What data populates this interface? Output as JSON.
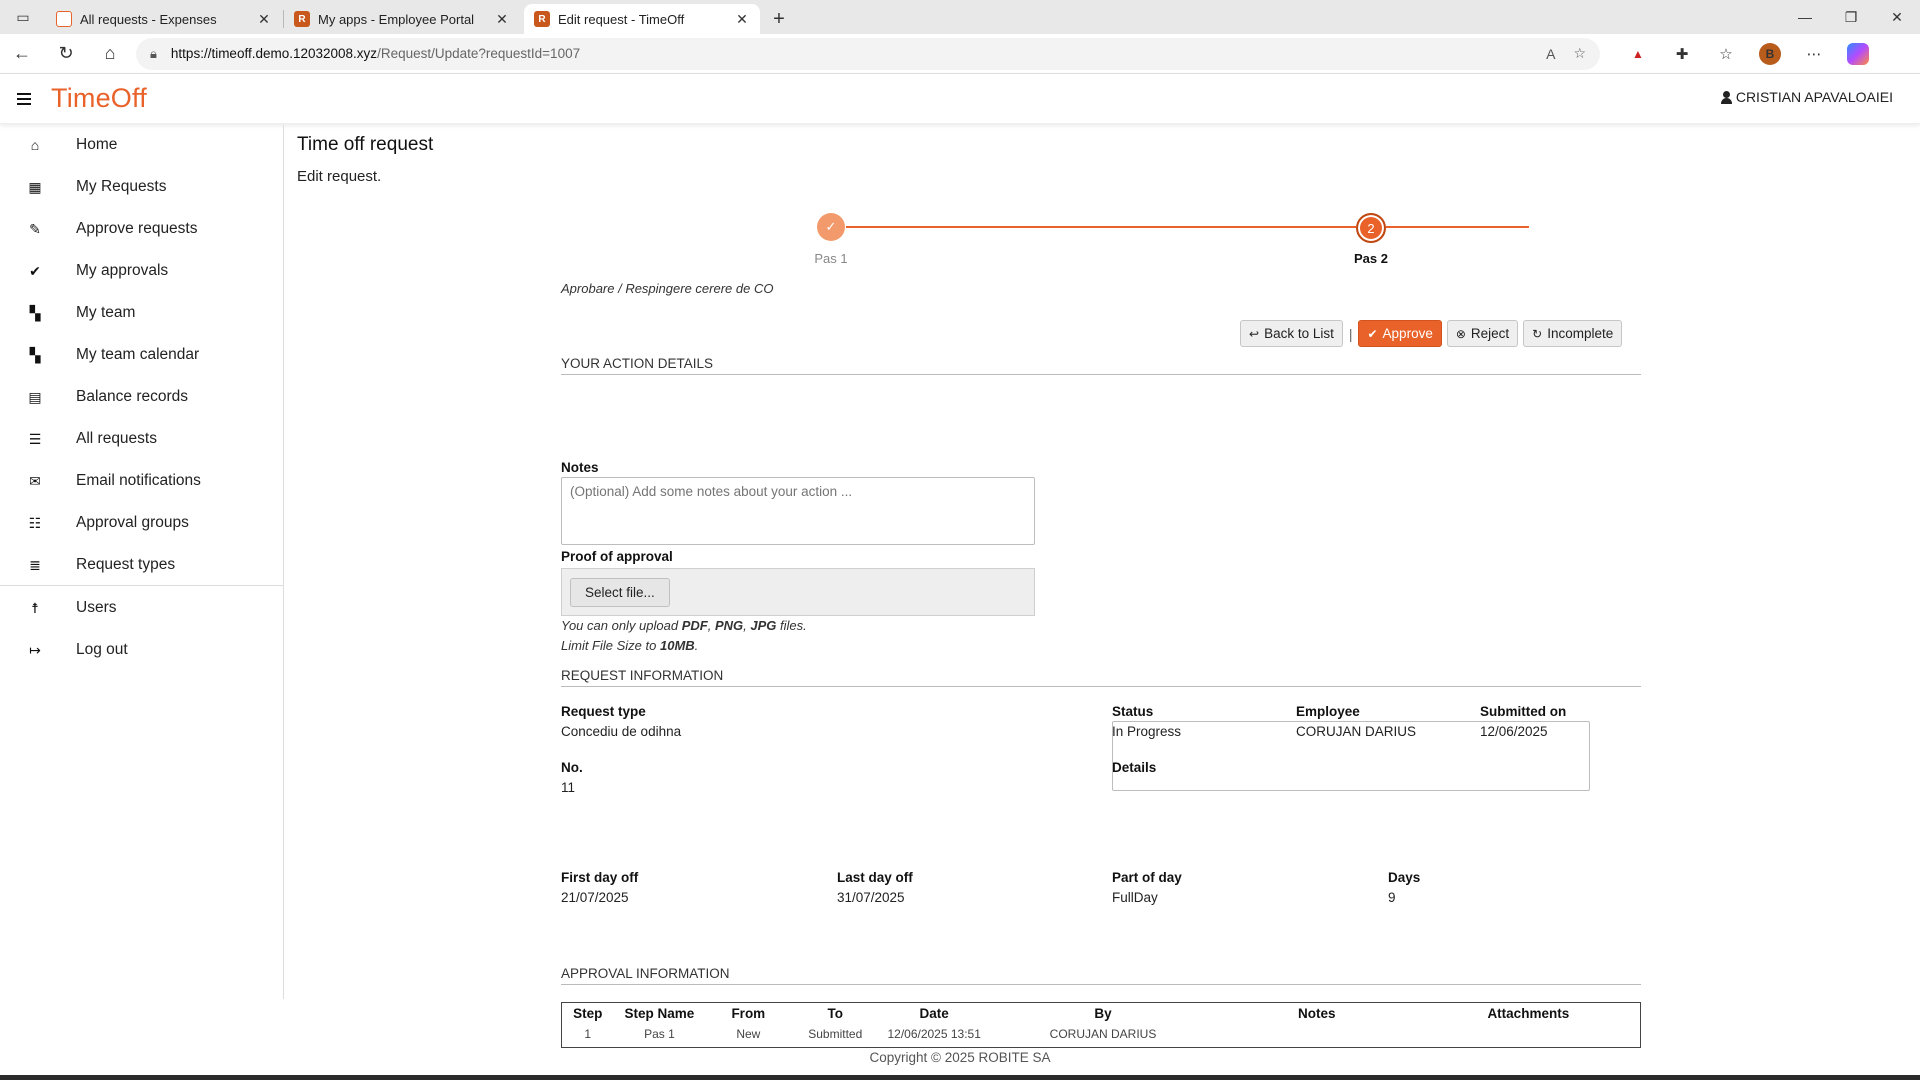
{
  "browser": {
    "tabs": [
      {
        "title": "All requests - Expenses",
        "active": false
      },
      {
        "title": "My apps - Employee Portal",
        "active": false
      },
      {
        "title": "Edit request - TimeOff",
        "active": true
      }
    ],
    "url_host": "https://timeoff.demo.12032008.xyz",
    "url_path": "/Request/Update?requestId=1007"
  },
  "app": {
    "brand": "TimeOff",
    "user": "CRISTIAN APAVALOAIEI",
    "accent": "#e8622a"
  },
  "sidebar": {
    "items": [
      {
        "label": "Home",
        "icon": "home-icon"
      },
      {
        "label": "My Requests",
        "icon": "calendar-icon"
      },
      {
        "label": "Approve requests",
        "icon": "pencil-icon"
      },
      {
        "label": "My approvals",
        "icon": "check-circle-icon"
      },
      {
        "label": "My team",
        "icon": "grid-icon"
      },
      {
        "label": "My team calendar",
        "icon": "grid-icon"
      },
      {
        "label": "Balance records",
        "icon": "calendar-balance-icon"
      },
      {
        "label": "All requests",
        "icon": "list-icon"
      },
      {
        "label": "Email notifications",
        "icon": "envelope-icon"
      },
      {
        "label": "Approval groups",
        "icon": "list-check-icon"
      },
      {
        "label": "Request types",
        "icon": "list-lines-icon"
      },
      {
        "label": "Users",
        "icon": "person-icon"
      },
      {
        "label": "Log out",
        "icon": "logout-icon"
      }
    ]
  },
  "page": {
    "title": "Time off request",
    "subtitle": "Edit request."
  },
  "stepper": {
    "steps": [
      {
        "label": "Pas 1",
        "status": "done",
        "marker": "✓"
      },
      {
        "label": "Pas 2",
        "status": "current",
        "marker": "2"
      }
    ],
    "caption": "Aprobare / Respingere cerere de CO"
  },
  "actions": {
    "back": "Back to List",
    "separator": "|",
    "approve": "Approve",
    "reject": "Reject",
    "incomplete": "Incomplete"
  },
  "action_details": {
    "section_title": "YOUR ACTION DETAILS",
    "notes_label": "Notes",
    "notes_placeholder": "(Optional) Add some notes about your action ...",
    "proof_label": "Proof of approval",
    "select_file": "Select file...",
    "hint_prefix": "You can only upload ",
    "hint_pdf": "PDF",
    "hint_comma1": ", ",
    "hint_png": "PNG",
    "hint_comma2": ", ",
    "hint_jpg": "JPG",
    "hint_suffix": " files.",
    "limit_prefix": "Limit File Size to ",
    "limit_value": "10MB",
    "limit_suffix": "."
  },
  "request_info": {
    "section_title": "REQUEST INFORMATION",
    "request_type_label": "Request type",
    "request_type": "Concediu de odihna",
    "status_label": "Status",
    "status": "In Progress",
    "employee_label": "Employee",
    "employee": "CORUJAN DARIUS",
    "submitted_label": "Submitted on",
    "submitted": "12/06/2025",
    "no_label": "No.",
    "no": "11",
    "details_label": "Details",
    "first_day_label": "First day off",
    "first_day": "21/07/2025",
    "last_day_label": "Last day off",
    "last_day": "31/07/2025",
    "part_label": "Part of day",
    "part": "FullDay",
    "days_label": "Days",
    "days": "9"
  },
  "approval_info": {
    "section_title": "APPROVAL INFORMATION",
    "columns": [
      "Step",
      "Step Name",
      "From",
      "To",
      "Date",
      "By",
      "Notes",
      "Attachments"
    ],
    "rows": [
      [
        "1",
        "Pas 1",
        "New",
        "Submitted",
        "12/06/2025 13:51",
        "CORUJAN DARIUS",
        "",
        ""
      ]
    ]
  },
  "footer": "Copyright © 2025 ROBITE SA"
}
